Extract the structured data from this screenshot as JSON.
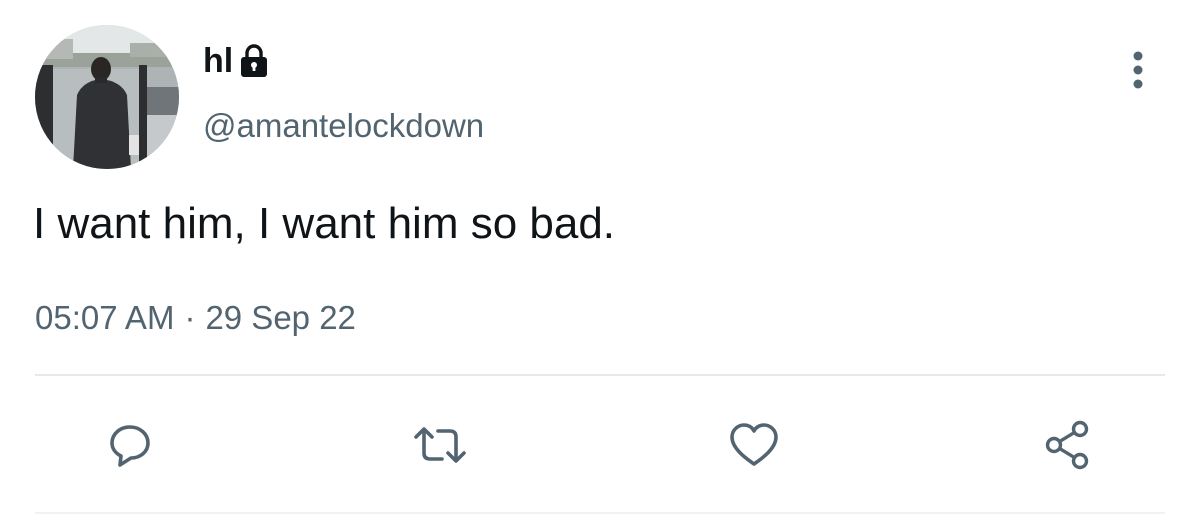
{
  "user": {
    "display_name": "hl",
    "handle": "@amantelockdown",
    "avatar": "avatar",
    "protected_icon": "lock-icon"
  },
  "tweet": {
    "text": "I want him, I want him so bad.",
    "time": "05:07 AM",
    "separator": "·",
    "date": "29 Sep 22"
  },
  "actions": {
    "reply_icon": "reply-icon",
    "retweet_icon": "retweet-icon",
    "like_icon": "heart-icon",
    "share_icon": "share-icon",
    "more_icon": "more-vertical-icon"
  },
  "colors": {
    "primary_text": "#0f1419",
    "secondary_text": "#536471",
    "divider": "#e6e9eb",
    "icon": "#536471"
  }
}
